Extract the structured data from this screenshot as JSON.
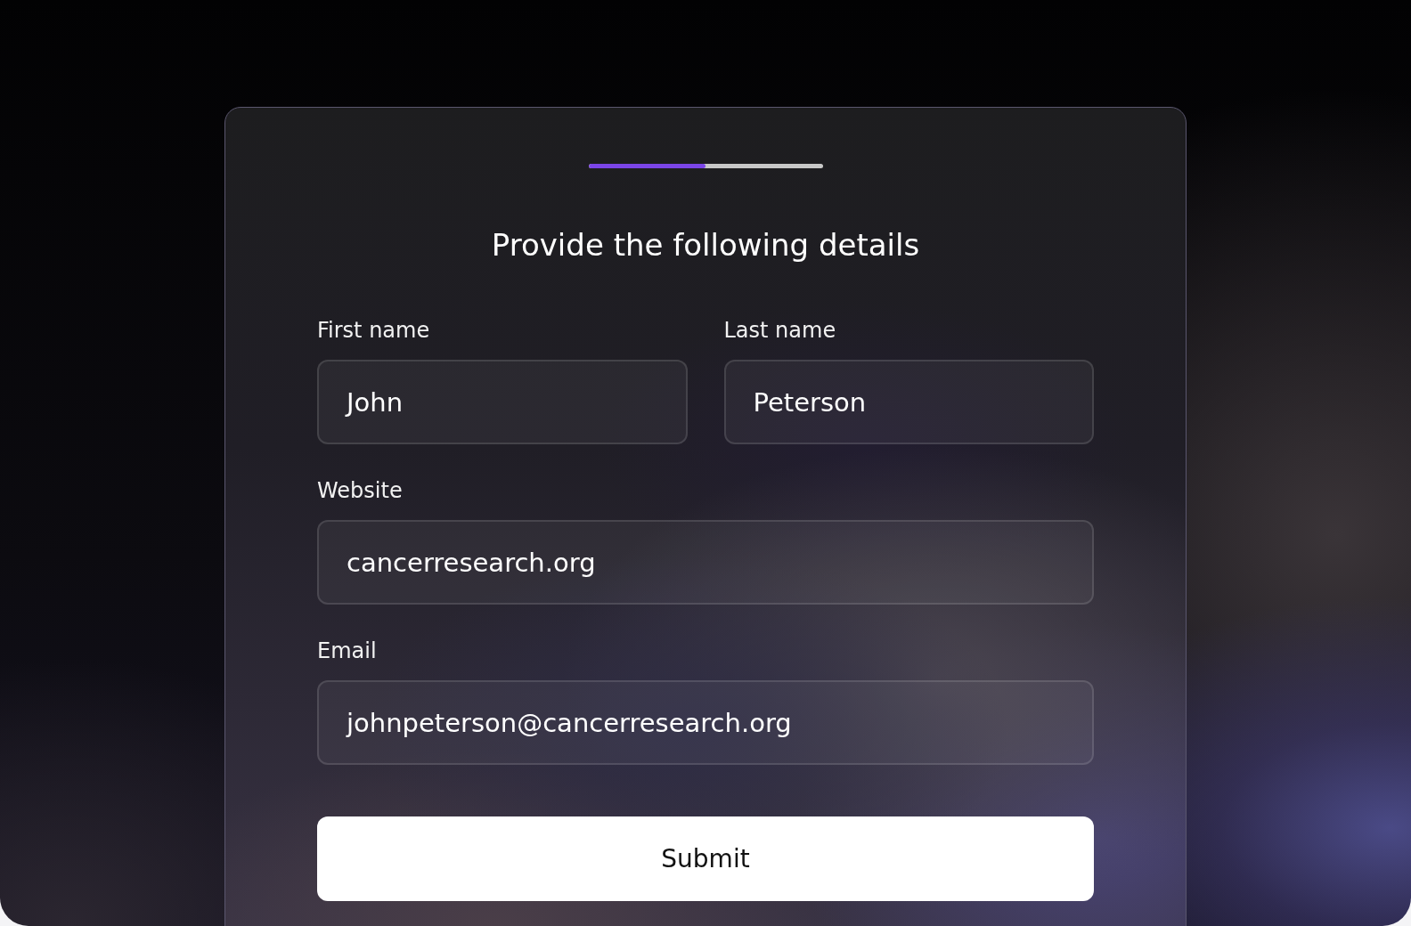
{
  "progress": {
    "level": 0.5
  },
  "title": "Provide the following details",
  "rows": [
    {
      "fields": [
        {
          "label": "First name",
          "value": "John"
        },
        {
          "label": "Last name",
          "value": "Peterson"
        }
      ]
    },
    {
      "fields": [
        {
          "label": "Website",
          "value": "cancerresearch.org"
        }
      ]
    },
    {
      "fields": [
        {
          "label": "Email",
          "value": "johnpeterson@cancerresearch.org"
        }
      ]
    }
  ],
  "submit_button": "Submit"
}
